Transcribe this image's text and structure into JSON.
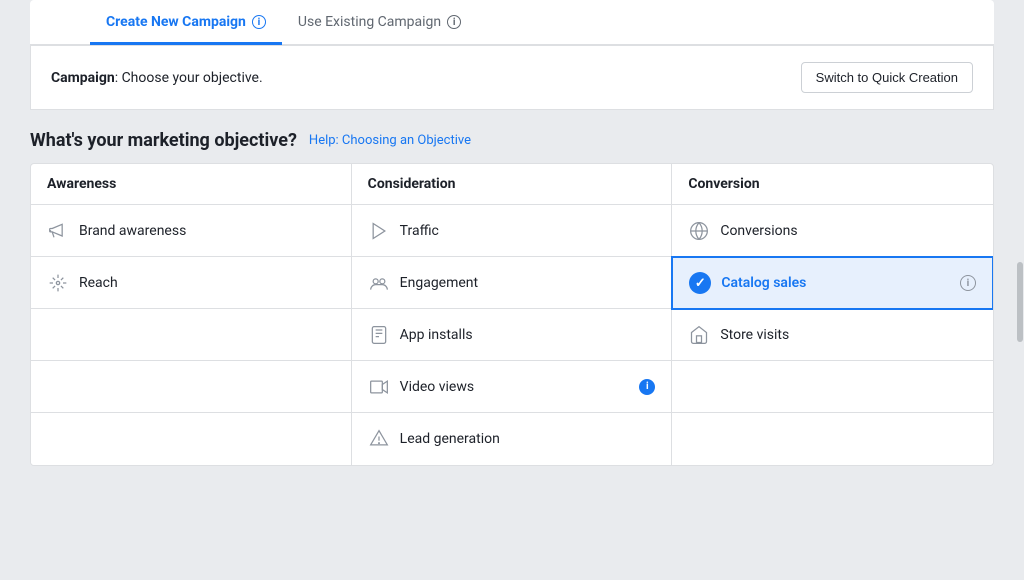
{
  "tabs": [
    {
      "id": "create-new",
      "label": "Create New Campaign",
      "active": true
    },
    {
      "id": "use-existing",
      "label": "Use Existing Campaign",
      "active": false
    }
  ],
  "campaign_header": {
    "prefix": "Campaign",
    "suffix": ": Choose your objective.",
    "button_label": "Switch to Quick Creation"
  },
  "objective_section": {
    "title": "What's your marketing objective?",
    "help_link": "Help: Choosing an Objective",
    "columns": [
      {
        "header": "Awareness",
        "items": [
          {
            "id": "brand-awareness",
            "label": "Brand awareness",
            "icon": "megaphone",
            "selected": false,
            "has_info": false
          },
          {
            "id": "reach",
            "label": "Reach",
            "icon": "reach",
            "selected": false,
            "has_info": false
          },
          {
            "id": "empty1",
            "label": "",
            "empty": true
          },
          {
            "id": "empty2",
            "label": "",
            "empty": true
          },
          {
            "id": "empty3",
            "label": "",
            "empty": true
          }
        ]
      },
      {
        "header": "Consideration",
        "items": [
          {
            "id": "traffic",
            "label": "Traffic",
            "icon": "traffic",
            "selected": false,
            "has_info": false
          },
          {
            "id": "engagement",
            "label": "Engagement",
            "icon": "engagement",
            "selected": false,
            "has_info": false
          },
          {
            "id": "app-installs",
            "label": "App installs",
            "icon": "app-installs",
            "selected": false,
            "has_info": false
          },
          {
            "id": "video-views",
            "label": "Video views",
            "icon": "video-views",
            "selected": false,
            "has_info": true
          },
          {
            "id": "lead-generation",
            "label": "Lead generation",
            "icon": "lead-generation",
            "selected": false,
            "has_info": false
          }
        ]
      },
      {
        "header": "Conversion",
        "items": [
          {
            "id": "conversions",
            "label": "Conversions",
            "icon": "globe",
            "selected": false,
            "has_info": false
          },
          {
            "id": "catalog-sales",
            "label": "Catalog sales",
            "icon": "catalog",
            "selected": true,
            "has_info": true
          },
          {
            "id": "store-visits",
            "label": "Store visits",
            "icon": "store",
            "selected": false,
            "has_info": false
          },
          {
            "id": "empty4",
            "label": "",
            "empty": true
          },
          {
            "id": "empty5",
            "label": "",
            "empty": true
          }
        ]
      }
    ]
  }
}
